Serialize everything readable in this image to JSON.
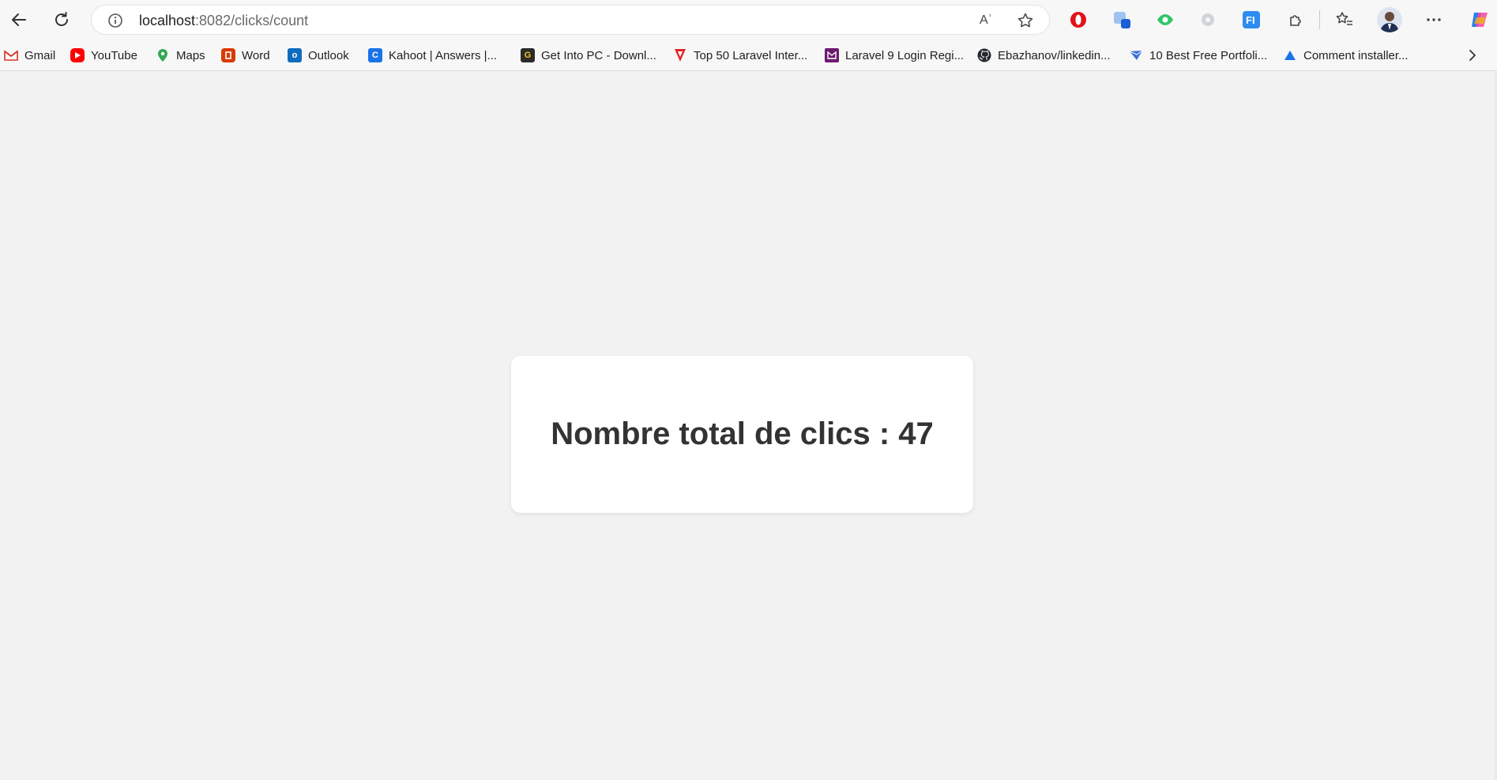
{
  "browser": {
    "url_host": "localhost",
    "url_path": ":8082/clicks/count",
    "read_aloud_icon_text": "Aʾ"
  },
  "bookmarks": [
    {
      "label": "Gmail",
      "icon": "gmail-icon",
      "color": "#d93025"
    },
    {
      "label": "YouTube",
      "icon": "youtube-icon",
      "color": "#ff0000"
    },
    {
      "label": "Maps",
      "icon": "maps-icon",
      "color": "#34a853"
    },
    {
      "label": "Word",
      "icon": "office-icon",
      "color": "#d83b01"
    },
    {
      "label": "Outlook",
      "icon": "outlook-icon",
      "color": "#0f6cbd"
    },
    {
      "label": "Kahoot | Answers |...",
      "icon": "kahoot-icon",
      "color": "#1a73e8",
      "glyph": "C"
    },
    {
      "label": "Get Into PC - Downl...",
      "icon": "getintopc-icon",
      "color": "#2b2b2b",
      "glyph": "G"
    },
    {
      "label": "Top 50 Laravel Inter...",
      "icon": "laravel-icon",
      "color": "#e3242b"
    },
    {
      "label": "Laravel 9 Login Regi...",
      "icon": "site-icon",
      "color": "#6d1a6e"
    },
    {
      "label": "Ebazhanov/linkedin...",
      "icon": "github-icon",
      "color": "#24292f"
    },
    {
      "label": "10 Best Free Portfoli...",
      "icon": "portfolio-icon",
      "color": "#3b6fd8"
    },
    {
      "label": "Comment installer...",
      "icon": "triangle-icon",
      "color": "#1a73e8"
    }
  ],
  "page": {
    "heading": "Nombre total de clics : 47"
  },
  "colors": {
    "page_bg": "#f2f2f2",
    "card_bg": "#ffffff",
    "heading": "#333333"
  }
}
